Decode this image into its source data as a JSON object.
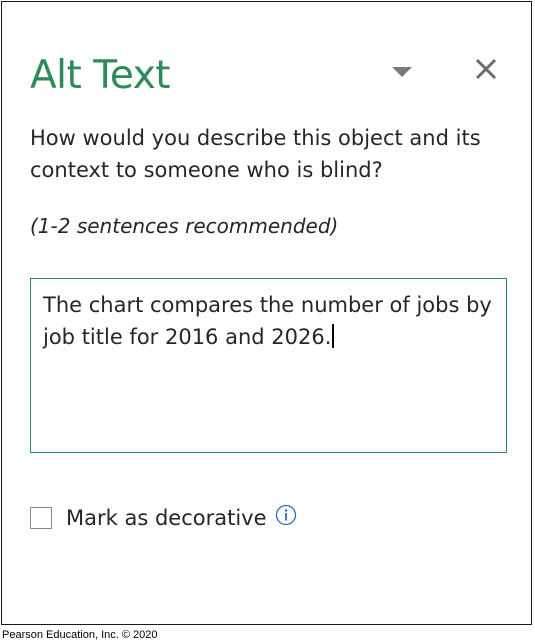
{
  "pane": {
    "title": "Alt Text",
    "menu_icon": "chevron-down-icon",
    "close_icon": "close-icon"
  },
  "question": "How would you describe this object and its context to someone who is blind?",
  "hint": "(1-2 sentences recommended)",
  "description": {
    "value": "The chart compares the number of jobs by job title for 2016 and 2026."
  },
  "decorative": {
    "label": "Mark as decorative",
    "checked": false,
    "info_icon": "info-icon"
  },
  "credit": "Pearson Education, Inc. © 2020",
  "colors": {
    "accent": "#2e8a57",
    "text": "#262626",
    "info": "#2b6cc4"
  }
}
